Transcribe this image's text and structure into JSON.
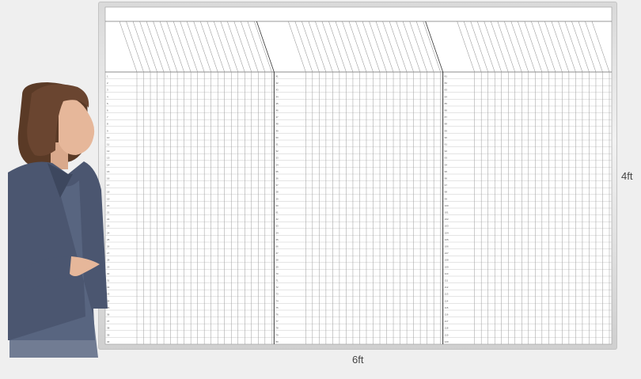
{
  "dimensions": {
    "width_label": "6ft",
    "height_label": "4ft"
  },
  "board": {
    "sections": 3,
    "columns_per_section": 20,
    "rows_per_section": 40,
    "row_number_color": "#555555",
    "grid_color": "#9a9a9a",
    "frame_color": "#d6d6d6"
  },
  "presenter": {
    "hair_color": "#5a3a26",
    "suit_color": "#4b5670",
    "skin_color": "#e6b79a"
  }
}
